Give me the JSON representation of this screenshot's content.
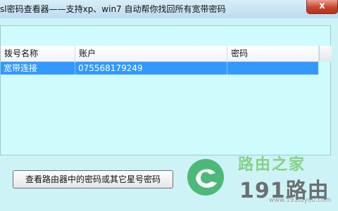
{
  "window": {
    "title": "sl密码查看器——支持xp、win7 自动帮你找回所有宽带密码",
    "close_label": "x"
  },
  "list": {
    "columns": [
      {
        "label": "拨号名称"
      },
      {
        "label": "账户"
      },
      {
        "label": "密码"
      }
    ],
    "rows": [
      {
        "name": "宽带连接",
        "account": "075568179249",
        "password": ""
      }
    ]
  },
  "actions": {
    "view_router_label": "查看路由器中的密码或其它星号密码"
  },
  "watermark": {
    "text_cn": "路由之家",
    "text_num": "191路由",
    "url": "www.191luyou.com",
    "colors": {
      "green": "#3fb36b",
      "gray": "#5a5a5a"
    }
  },
  "colors": {
    "selection": "#3399ff",
    "list_background": "#cefbfb",
    "close_button": "#c8452e"
  }
}
